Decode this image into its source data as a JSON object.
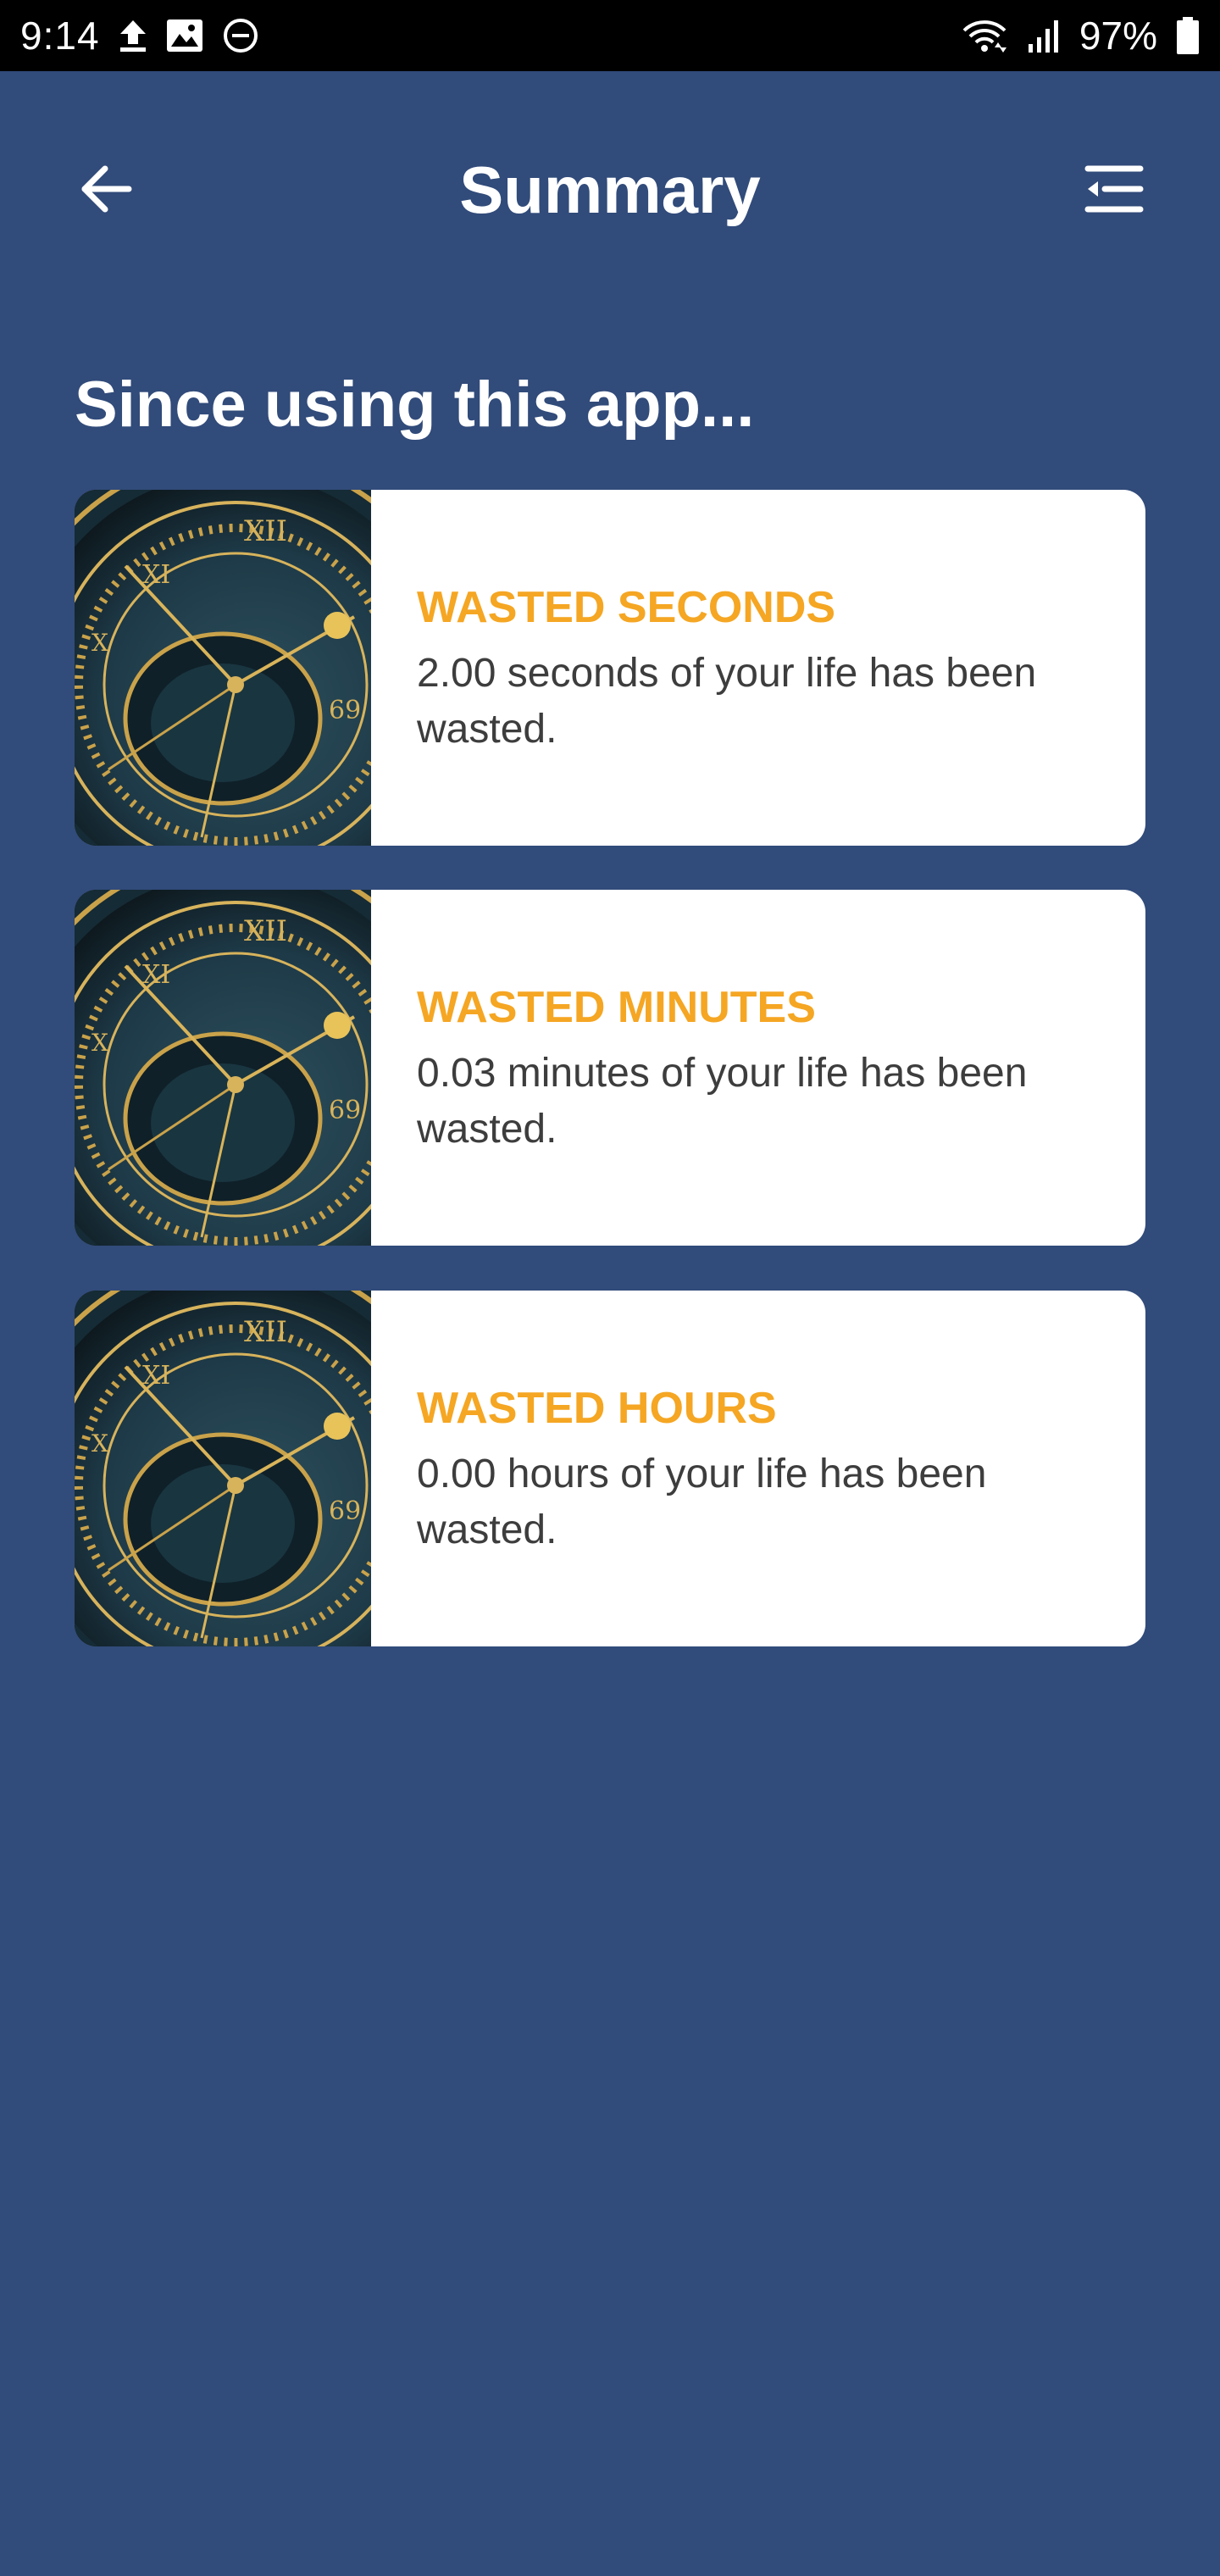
{
  "status_bar": {
    "time": "9:14",
    "battery": "97%",
    "left_icons": [
      "upload-icon",
      "image-icon",
      "do-not-disturb-icon"
    ],
    "right_icons": [
      "wifi-icon",
      "signal-icon",
      "battery-icon"
    ]
  },
  "header": {
    "title": "Summary",
    "back_icon": "arrow-left-icon",
    "menu_icon": "menu-collapse-icon"
  },
  "main": {
    "heading": "Since using this app...",
    "cards": [
      {
        "title": "WASTED SECONDS",
        "text": "2.00 seconds of your life has been wasted.",
        "image": "astronomical-clock-image"
      },
      {
        "title": "WASTED MINUTES",
        "text": "0.03 minutes of your life has been wasted.",
        "image": "astronomical-clock-image"
      },
      {
        "title": "WASTED HOURS",
        "text": "0.00 hours of your life has been wasted.",
        "image": "astronomical-clock-image"
      }
    ]
  },
  "colors": {
    "background": "#314b7a",
    "status_bar": "#000000",
    "card_background": "#ffffff",
    "card_title": "#f5a623",
    "card_text": "#3d3d3d"
  }
}
